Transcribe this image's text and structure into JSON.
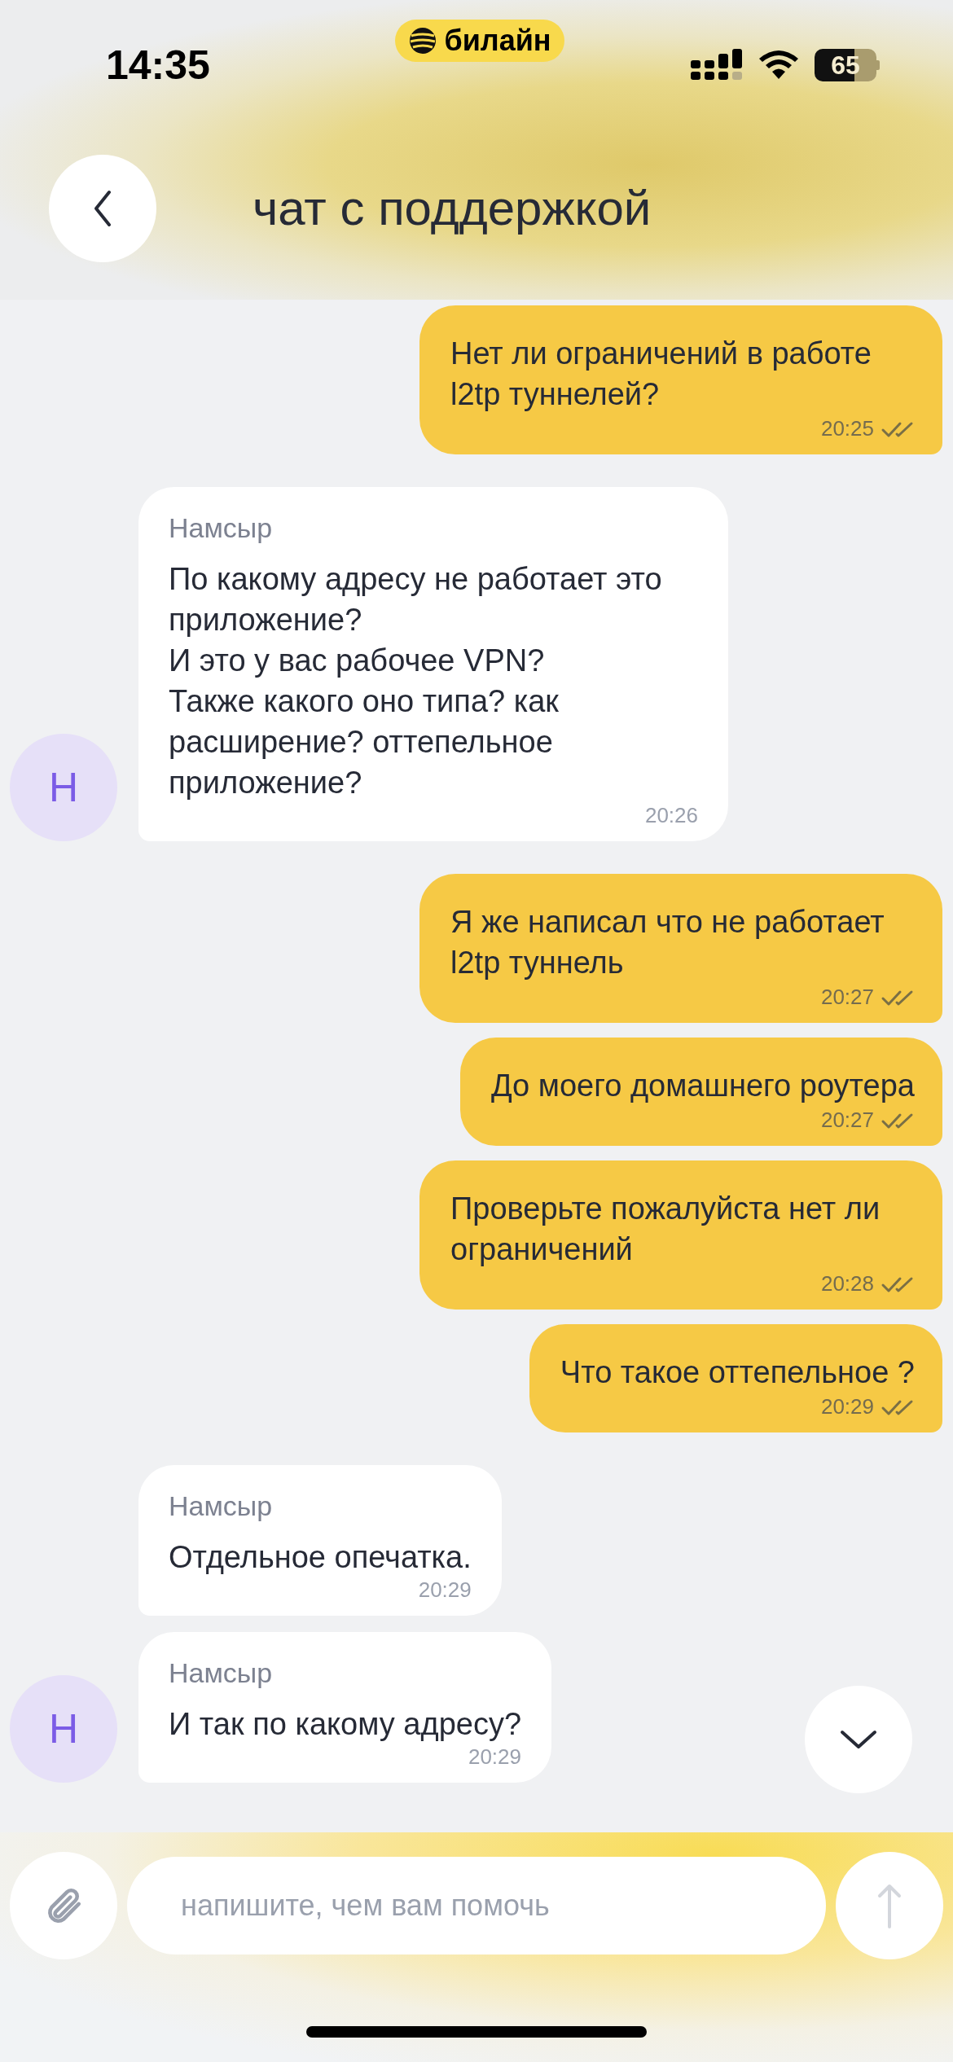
{
  "status_bar": {
    "time": "14:35",
    "carrier": "билайн",
    "battery": "65"
  },
  "header": {
    "title": "чат с поддержкой"
  },
  "messages": [
    {
      "kind": "outgoing",
      "text": "Нет ли ограничений в работе l2tp туннелей?",
      "time": "20:25",
      "read": true
    },
    {
      "kind": "incoming",
      "sender": "Намсыр",
      "text": "По какому адресу не работает это приложение?\nИ это у вас рабочее VPN?\nТакже какого оно типа? как расширение? оттепельное приложение?",
      "time": "20:26",
      "avatar": "Н"
    },
    {
      "kind": "outgoing",
      "text": "Я же написал что не работает l2tp туннель",
      "time": "20:27",
      "read": true
    },
    {
      "kind": "outgoing",
      "text": "До моего домашнего роутера",
      "time": "20:27",
      "read": true
    },
    {
      "kind": "outgoing",
      "text": "Проверьте пожалуйста нет ли ограничений",
      "time": "20:28",
      "read": true
    },
    {
      "kind": "outgoing",
      "text": "Что такое оттепельное ?",
      "time": "20:29",
      "read": true
    },
    {
      "kind": "incoming",
      "sender": "Намсыр",
      "text": "Отдельное опечатка.",
      "time": "20:29"
    },
    {
      "kind": "incoming",
      "sender": "Намсыр",
      "text": "И так по какому адресу?",
      "time": "20:29",
      "avatar": "Н"
    }
  ],
  "composer": {
    "placeholder": "напишите, чем вам помочь"
  }
}
